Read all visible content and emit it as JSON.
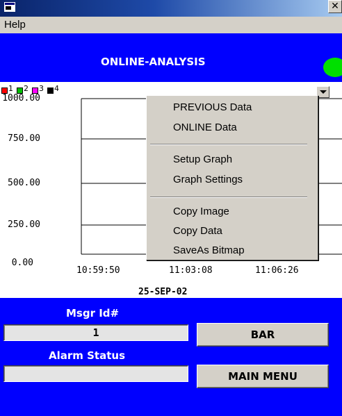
{
  "window": {
    "title": "",
    "close_glyph": "✕"
  },
  "menubar": {
    "help_label": "Help"
  },
  "header": {
    "title": "ONLINE-ANALYSIS",
    "status_color": "#00e000"
  },
  "chart_data": {
    "type": "line",
    "legend": [
      "1",
      "2",
      "3",
      "4"
    ],
    "legend_colors": [
      "#ff0000",
      "#00c000",
      "#ff00ff",
      "#000000"
    ],
    "y_ticks": [
      "1000.00",
      "750.00",
      "500.00",
      "250.00",
      "0.00"
    ],
    "x_ticks": [
      "10:59:50",
      "11:03:08",
      "11:06:26"
    ],
    "ylim": [
      0,
      1000
    ],
    "grid": true,
    "date_label": "25-SEP-02",
    "series": []
  },
  "context_menu": {
    "items": [
      "PREVIOUS Data",
      "ONLINE Data",
      "Setup Graph",
      "Graph Settings",
      "Copy Image",
      "Copy Data",
      "SaveAs Bitmap"
    ]
  },
  "form": {
    "msgr_label": "Msgr Id#",
    "msgr_value": "1",
    "alarm_label": "Alarm Status",
    "alarm_value": "",
    "bar_button": "BAR",
    "main_menu_button": "MAIN MENU"
  },
  "colors": {
    "panel_blue": "#0000ff",
    "title_gradient_start": "#0a246a"
  }
}
